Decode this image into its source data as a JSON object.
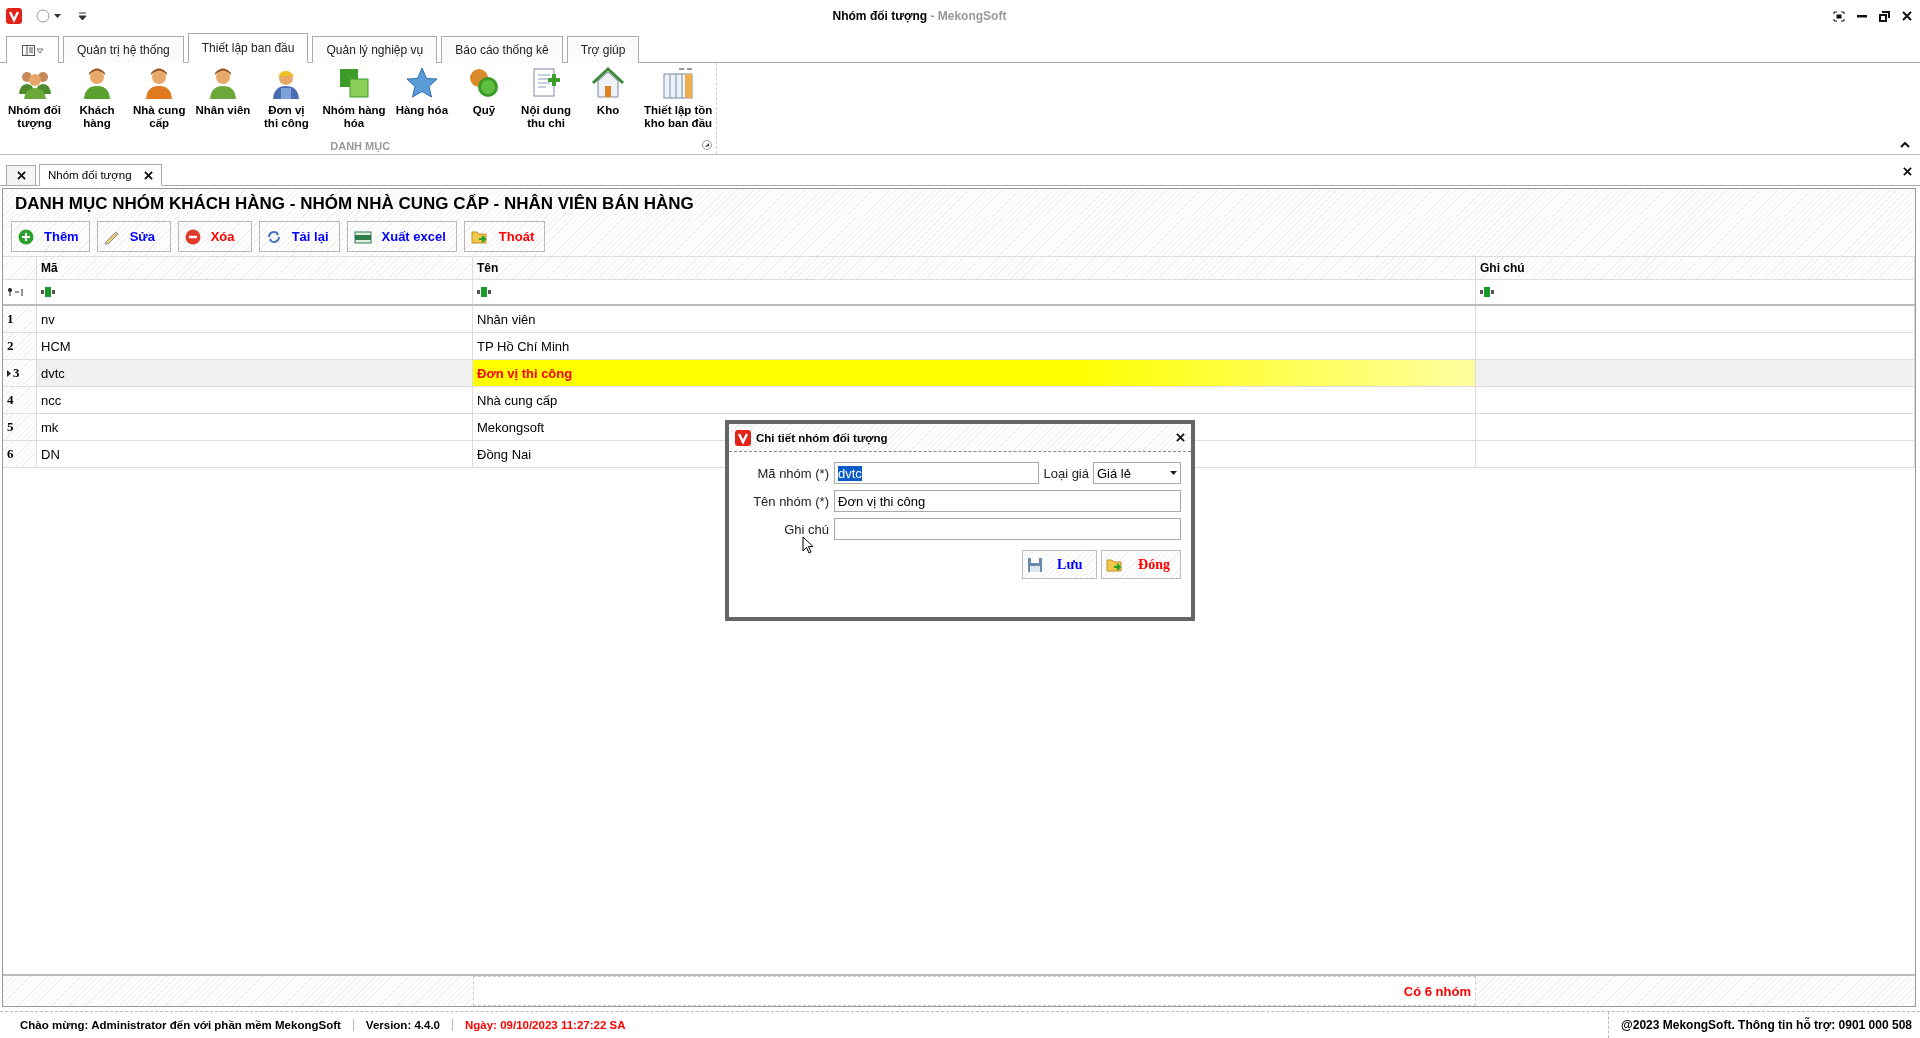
{
  "window": {
    "title": "Nhóm đối tượng",
    "app_name": "- MekongSoft"
  },
  "ribbon": {
    "tabs": [
      {
        "label": "Quản trị hệ thống",
        "selected": false
      },
      {
        "label": "Thiết lập ban đầu",
        "selected": true
      },
      {
        "label": "Quản lý nghiệp vụ",
        "selected": false
      },
      {
        "label": "Báo cáo thống kê",
        "selected": false
      },
      {
        "label": "Trợ giúp",
        "selected": false
      }
    ],
    "items": [
      {
        "label": "Nhóm đối\ntượng"
      },
      {
        "label": "Khách\nhàng"
      },
      {
        "label": "Nhà cung\ncấp"
      },
      {
        "label": "Nhân viên"
      },
      {
        "label": "Đơn vị\nthi công"
      },
      {
        "label": "Nhóm hàng\nhóa"
      },
      {
        "label": "Hàng hóa"
      },
      {
        "label": "Quỹ"
      },
      {
        "label": "Nội dung\nthu chi"
      },
      {
        "label": "Kho"
      },
      {
        "label": "Thiết lập tồn\nkho ban đầu"
      }
    ],
    "group": "DANH MỤC"
  },
  "document_tabs": [
    {
      "label": "Nhóm đối tượng",
      "selected": true
    }
  ],
  "heading": "DANH MỤC NHÓM KHÁCH HÀNG - NHÓM NHÀ CUNG CẤP - NHÂN VIÊN BÁN HÀNG",
  "toolbar": [
    {
      "label": "Thêm",
      "color": "#0000ff"
    },
    {
      "label": "Sửa",
      "color": "#0000ff"
    },
    {
      "label": "Xóa",
      "color": "#ff0000"
    },
    {
      "label": "Tải lại",
      "color": "#0000ff"
    },
    {
      "label": "Xuất excel",
      "color": "#0000ff"
    },
    {
      "label": "Thoát",
      "color": "#ff0000"
    }
  ],
  "table": {
    "columns": [
      "Mã",
      "Tên",
      "Ghi chú"
    ],
    "rows": [
      {
        "number": "1",
        "code": "nv",
        "name": "Nhân viên",
        "selected": false
      },
      {
        "number": "2",
        "code": "HCM",
        "name": "TP Hồ Chí Minh",
        "selected": false
      },
      {
        "number": "3",
        "code": "dvtc",
        "name": "Đơn vị thi công",
        "selected": true
      },
      {
        "number": "4",
        "code": "ncc",
        "name": "Nhà cung cấp",
        "selected": false
      },
      {
        "number": "5",
        "code": "mk",
        "name": "Mekongsoft",
        "selected": false
      },
      {
        "number": "6",
        "code": "DN",
        "name": "Đồng Nai",
        "selected": false
      }
    ],
    "summary": "Có 6 nhóm"
  },
  "dialog": {
    "title": "Chi tiết nhóm đối tượng",
    "code": {
      "label": "Mã nhóm (*)",
      "value": "dvtc",
      "text_selected": true
    },
    "price_type": {
      "label": "Loại giá",
      "value": "Giá lẻ"
    },
    "name": {
      "label": "Tên nhóm (*)",
      "value": "Đơn vị thi công"
    },
    "note": {
      "label": "Ghi chú"
    },
    "buttons": [
      {
        "label": "Lưu",
        "color": "#0000ff"
      },
      {
        "label": "Đóng",
        "color": "#ff0000"
      }
    ]
  },
  "status_bar": {
    "welcome": "Chào mừng: Administrator đến với phần mềm MekongSoft",
    "version": "Version: 4.4.0",
    "date": "Ngày: 09/10/2023 11:27:22 SA",
    "copyright": "@2023 MekongSoft. Thông tin hỗ trợ: 0901 000 508"
  }
}
